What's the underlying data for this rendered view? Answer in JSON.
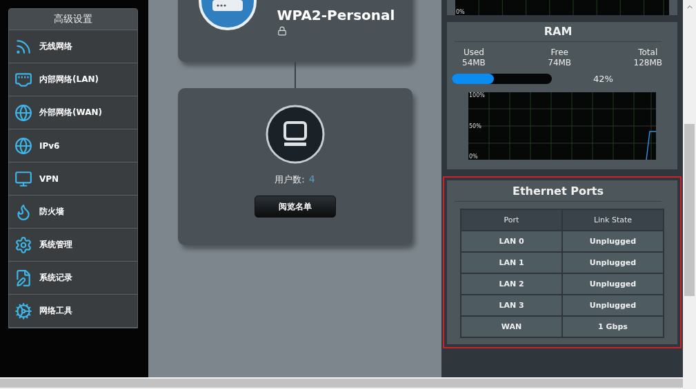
{
  "sidebar": {
    "title": "高级设置",
    "items": [
      {
        "label": "无线网络"
      },
      {
        "label": "内部网络(LAN)"
      },
      {
        "label": "外部网络(WAN)"
      },
      {
        "label": "IPv6"
      },
      {
        "label": "VPN"
      },
      {
        "label": "防火墙"
      },
      {
        "label": "系统管理"
      },
      {
        "label": "系统记录"
      },
      {
        "label": "网络工具"
      }
    ]
  },
  "network_map": {
    "wireless_card": {
      "security": "WPA2-Personal"
    },
    "clients_card": {
      "label": "用户数:",
      "count": "4",
      "button": "阅览名单"
    }
  },
  "status": {
    "cpu_graph": {
      "bottom_label": "0%"
    },
    "ram": {
      "title": "RAM",
      "stats": [
        {
          "label": "Used",
          "value": "54MB"
        },
        {
          "label": "Free",
          "value": "74MB"
        },
        {
          "label": "Total",
          "value": "128MB"
        }
      ],
      "level": 0.42,
      "percent": "42%",
      "graph_labels": [
        "100%",
        "50%",
        "0%"
      ]
    },
    "ethernet": {
      "title": "Ethernet Ports",
      "columns": [
        "Port",
        "Link State"
      ],
      "rows": [
        [
          "LAN 0",
          "Unplugged"
        ],
        [
          "LAN 1",
          "Unplugged"
        ],
        [
          "LAN 2",
          "Unplugged"
        ],
        [
          "LAN 3",
          "Unplugged"
        ],
        [
          "WAN",
          "1 Gbps"
        ]
      ]
    }
  }
}
